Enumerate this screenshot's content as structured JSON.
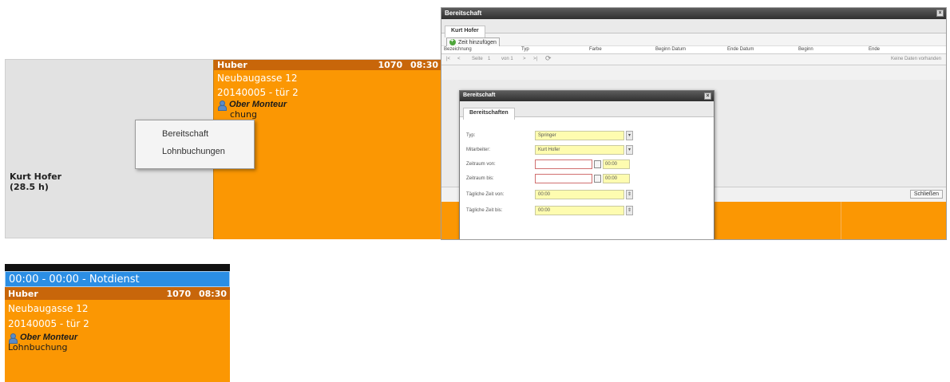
{
  "panel_a": {
    "resource_name": "Kurt Hofer",
    "resource_hours": "(28.5 h)",
    "job": {
      "customer": "Huber",
      "code": "1070",
      "time": "08:30",
      "address": "Neubaugasse 12",
      "order": "20140005 - tür 2",
      "role": "Ober Monteur",
      "note_partial": "chung"
    },
    "context_menu": [
      "Bereitschaft",
      "Lohnbuchungen"
    ]
  },
  "panel_b": {
    "window_title": "Bereitschaft",
    "tab": "Kurt Hofer",
    "add_button": "Zeit hinzufügen",
    "columns": [
      "Bezeichnung",
      "Typ",
      "Farbe",
      "Beginn Datum",
      "Ende Datum",
      "Beginn",
      "Ende"
    ],
    "pager": {
      "page_label": "Seite",
      "page_value": "1",
      "of_label": "von 1",
      "empty_text": "Keine Daten vorhanden"
    },
    "close_button": "Schließen",
    "dialog": {
      "title": "Bereitschaft",
      "tab": "Bereitschaften",
      "fields": {
        "typ_label": "Typ:",
        "typ_value": "Springer",
        "mitarbeiter_label": "Mitarbeiter:",
        "mitarbeiter_value": "Kurt Hofer",
        "zeitraum_von_label": "Zeitraum von:",
        "zeitraum_von_time": "00:00",
        "zeitraum_bis_label": "Zeitraum bis:",
        "zeitraum_bis_time": "00:00",
        "taeglich_von_label": "Tägliche Zeit von:",
        "taeglich_von_value": "00:00",
        "taeglich_bis_label": "Tägliche Zeit bis:",
        "taeglich_bis_value": "00:00"
      }
    }
  },
  "panel_c": {
    "standby": "00:00 - 00:00 - Notdienst",
    "customer": "Huber",
    "code": "1070",
    "time": "08:30",
    "address": "Neubaugasse 12",
    "order": "20140005 - tür 2",
    "role": "Ober Monteur",
    "note": "Lohnbuchung"
  },
  "colors": {
    "job_orange": "#fb9703",
    "header_brown": "#c8660a",
    "standby_blue": "#2b8ee4",
    "field_yellow": "#fefcb0"
  }
}
